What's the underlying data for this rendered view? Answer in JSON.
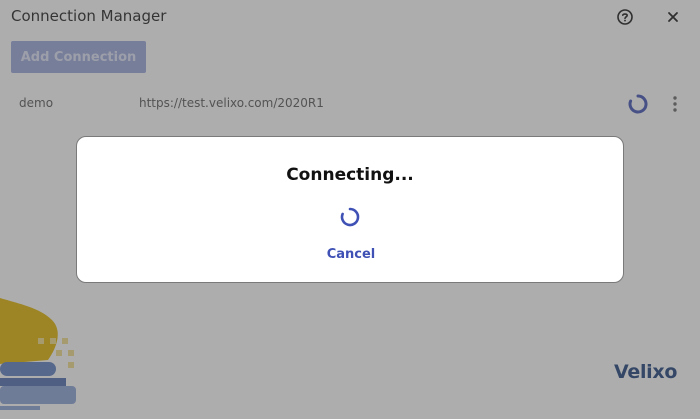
{
  "window": {
    "title": "Connection Manager",
    "help_icon": "help-circle-icon",
    "close_icon": "close-icon"
  },
  "toolbar": {
    "add_connection_label": "Add Connection"
  },
  "connections": [
    {
      "name": "demo",
      "url": "https://test.velixo.com/2020R1",
      "status_icon": "loading-spinner-icon",
      "menu_icon": "kebab-menu-icon"
    }
  ],
  "branding": {
    "logo_text": "Velixo"
  },
  "dialog": {
    "title": "Connecting...",
    "cancel_label": "Cancel",
    "spinner_icon": "loading-spinner-icon"
  },
  "colors": {
    "accent": "#3f51b5",
    "overlay": "#505050",
    "logo": "#1c3f7a",
    "decoration_gold": "#e0b400",
    "decoration_blue": "#5b7dbf"
  }
}
